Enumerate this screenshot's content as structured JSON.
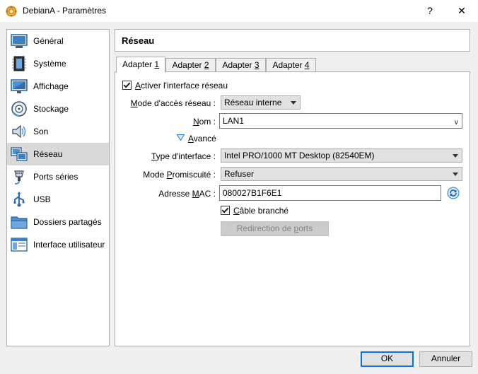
{
  "window": {
    "title": "DebianA - Paramètres",
    "help_label": "?",
    "close_label": "✕",
    "icon": "virtualbox-icon"
  },
  "sidebar": {
    "items": [
      {
        "label": "Général",
        "icon": "general-icon"
      },
      {
        "label": "Système",
        "icon": "system-chip-icon"
      },
      {
        "label": "Affichage",
        "icon": "display-monitor-icon"
      },
      {
        "label": "Stockage",
        "icon": "storage-disk-icon"
      },
      {
        "label": "Son",
        "icon": "speaker-icon"
      },
      {
        "label": "Réseau",
        "icon": "network-icon",
        "selected": true
      },
      {
        "label": "Ports séries",
        "icon": "serial-port-icon"
      },
      {
        "label": "USB",
        "icon": "usb-icon"
      },
      {
        "label": "Dossiers partagés",
        "icon": "shared-folder-icon"
      },
      {
        "label": "Interface utilisateur",
        "icon": "user-interface-icon"
      }
    ]
  },
  "header": {
    "title": "Réseau"
  },
  "tabs": [
    {
      "prefix": "Adapter ",
      "key": "1",
      "active": true
    },
    {
      "prefix": "Adapter ",
      "key": "2",
      "active": false
    },
    {
      "prefix": "Adapter ",
      "key": "3",
      "active": false
    },
    {
      "prefix": "Adapter ",
      "key": "4",
      "active": false
    }
  ],
  "adapter": {
    "enable": {
      "key": "A",
      "rest": "ctiver l'interface réseau",
      "checked": true
    },
    "access_mode": {
      "label_pre": "",
      "key": "M",
      "label_post": "ode d'accès réseau :",
      "value": "Réseau interne"
    },
    "name": {
      "label_pre": "",
      "key": "N",
      "label_post": "om :",
      "value": "LAN1"
    },
    "advanced": {
      "label_pre": "",
      "key": "A",
      "label_post": "vancé",
      "expanded": true
    },
    "interface_type": {
      "label_pre": "",
      "key": "T",
      "label_post": "ype d'interface :",
      "value": "Intel PRO/1000 MT Desktop (82540EM)"
    },
    "promiscuous": {
      "label_pre": "Mode ",
      "key": "P",
      "label_post": "romiscuité :",
      "value": "Refuser"
    },
    "mac": {
      "label_pre": "Adresse ",
      "key": "M",
      "label_post": "AC :",
      "value": "080027B1F6E1",
      "refresh_icon": "refresh-mac-icon"
    },
    "cable": {
      "label_pre": "",
      "key": "C",
      "label_post": "âble branché",
      "checked": true
    },
    "port_forwarding": {
      "label_pre": "Redirection de ",
      "key": "p",
      "label_post": "orts",
      "enabled": false
    }
  },
  "footer": {
    "ok_label": "OK",
    "cancel_label": "Annuler"
  },
  "colors": {
    "accent": "#0078d7",
    "selection": "#d9d9d9",
    "border": "#adadad"
  }
}
